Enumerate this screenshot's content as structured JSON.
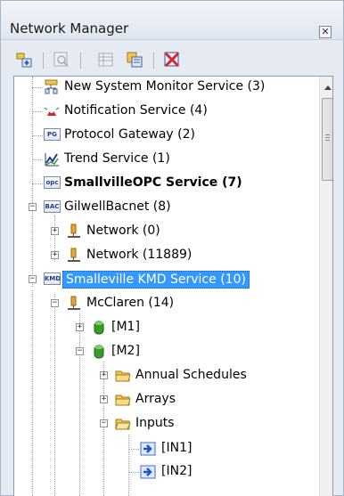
{
  "window": {
    "title": "Network Manager",
    "close_glyph": "✕"
  },
  "toolbar": {
    "items": [
      {
        "icon": "add-service-icon"
      },
      {
        "icon": "properties-icon"
      },
      {
        "icon": "grid-view-icon"
      },
      {
        "icon": "copy-icon"
      },
      {
        "icon": "delete-icon"
      }
    ]
  },
  "tree": {
    "items": [
      {
        "label": "New System Monitor Service (3)",
        "icon": "system-monitor-icon"
      },
      {
        "label": "Notification Service (4)",
        "icon": "notification-icon"
      },
      {
        "label": "Protocol Gateway (2)",
        "icon": "protocol-gateway-icon",
        "badge": "PG"
      },
      {
        "label": "Trend Service (1)",
        "icon": "trend-icon"
      },
      {
        "label": "SmallvilleOPC Service (7)",
        "icon": "opc-icon",
        "badge": "opc",
        "bold": true
      },
      {
        "label": "GilwellBacnet (8)",
        "icon": "bacnet-icon",
        "badge": "BAC",
        "expander": "−"
      },
      {
        "label": "Network (0)",
        "icon": "network-icon",
        "expander": "+"
      },
      {
        "label": "Network (11889)",
        "icon": "network-icon",
        "expander": "+"
      },
      {
        "label": "Smalleville KMD Service (10)",
        "icon": "kmd-icon",
        "badge": "KMD",
        "expander": "−",
        "selected": true
      },
      {
        "label": "McClaren (14)",
        "icon": "network-icon",
        "expander": "−"
      },
      {
        "label": "[M1]",
        "icon": "device-icon",
        "expander": "+"
      },
      {
        "label": "[M2]",
        "icon": "device-icon",
        "expander": "−"
      },
      {
        "label": "Annual Schedules",
        "icon": "folder-icon",
        "expander": "+"
      },
      {
        "label": "Arrays",
        "icon": "folder-icon",
        "expander": "+"
      },
      {
        "label": "Inputs",
        "icon": "folder-open-icon",
        "expander": "−"
      },
      {
        "label": "[IN1]",
        "icon": "input-point-icon"
      },
      {
        "label": "[IN2]",
        "icon": "input-point-icon"
      }
    ]
  },
  "colors": {
    "selection": "#3399ff",
    "device_green": "#3a9a2a",
    "folder_yellow": "#f2c84b",
    "network_orange": "#e8a33a"
  }
}
